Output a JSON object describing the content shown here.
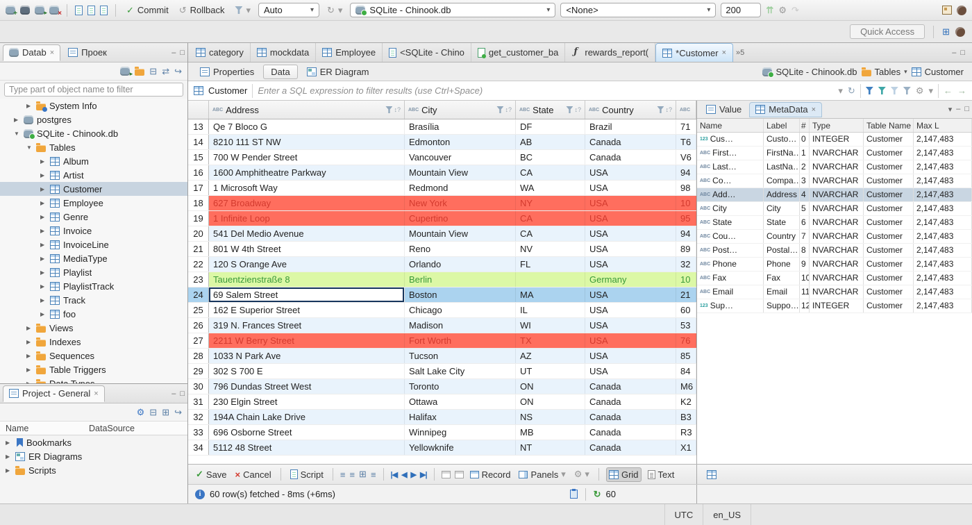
{
  "icons": {
    "caret": "▾",
    "close": "×",
    "check": "✓",
    "cross": "×",
    "gear": "⚙",
    "refresh": "↻",
    "history": "↺",
    "sort_hint": "↕?",
    "lines": "≡",
    "nav_first": "|◀",
    "nav_prev": "◀",
    "nav_next": "▶",
    "nav_last": "▶|",
    "min": "–",
    "max": "□",
    "collapse_all": "⊟",
    "expand_all": "⊞",
    "link_editor": "⇄",
    "jump": "↪",
    "up2": "⇈",
    "redo": "↷",
    "back_arrow": "←",
    "fwd_arrow": "→",
    "overflow": "»"
  },
  "toolbar": {
    "commit_label": "Commit",
    "rollback_label": "Rollback",
    "tx_mode": "Auto",
    "database": "SQLite - Chinook.db",
    "schema": "<None>",
    "fetch_size": "200",
    "quick_access": "Quick Access"
  },
  "navigator": {
    "tab_database": "Datab",
    "tab_project": "Проек",
    "filter_placeholder": "Type part of object name to filter",
    "tree": [
      {
        "arrow": "▶",
        "label": "System Info",
        "row_class": "d2",
        "icon_class": "i-folder i-folder-info"
      },
      {
        "arrow": "▶",
        "label": "postgres",
        "row_class": "d1",
        "icon_class": "i-db"
      },
      {
        "arrow": "▼",
        "label": "SQLite - Chinook.db",
        "row_class": "d1",
        "icon_class": "i-db i-db-on"
      },
      {
        "arrow": "▼",
        "label": "Tables",
        "row_class": "d2",
        "icon_class": "i-folder"
      },
      {
        "arrow": "▶",
        "label": "Album",
        "row_class": "d3",
        "icon_class": "i-table"
      },
      {
        "arrow": "▶",
        "label": "Artist",
        "row_class": "d3",
        "icon_class": "i-table"
      },
      {
        "arrow": "▶",
        "label": "Customer",
        "row_class": "d3 selected",
        "icon_class": "i-table"
      },
      {
        "arrow": "▶",
        "label": "Employee",
        "row_class": "d3",
        "icon_class": "i-table"
      },
      {
        "arrow": "▶",
        "label": "Genre",
        "row_class": "d3",
        "icon_class": "i-table"
      },
      {
        "arrow": "▶",
        "label": "Invoice",
        "row_class": "d3",
        "icon_class": "i-table"
      },
      {
        "arrow": "▶",
        "label": "InvoiceLine",
        "row_class": "d3",
        "icon_class": "i-table"
      },
      {
        "arrow": "▶",
        "label": "MediaType",
        "row_class": "d3",
        "icon_class": "i-table"
      },
      {
        "arrow": "▶",
        "label": "Playlist",
        "row_class": "d3",
        "icon_class": "i-table"
      },
      {
        "arrow": "▶",
        "label": "PlaylistTrack",
        "row_class": "d3",
        "icon_class": "i-table"
      },
      {
        "arrow": "▶",
        "label": "Track",
        "row_class": "d3",
        "icon_class": "i-table"
      },
      {
        "arrow": "▶",
        "label": "foo",
        "row_class": "d3",
        "icon_class": "i-table"
      },
      {
        "arrow": "▶",
        "label": "Views",
        "row_class": "d2",
        "icon_class": "i-folder"
      },
      {
        "arrow": "▶",
        "label": "Indexes",
        "row_class": "d2",
        "icon_class": "i-folder"
      },
      {
        "arrow": "▶",
        "label": "Sequences",
        "row_class": "d2",
        "icon_class": "i-folder"
      },
      {
        "arrow": "▶",
        "label": "Table Triggers",
        "row_class": "d2",
        "icon_class": "i-folder"
      },
      {
        "arrow": "▶",
        "label": "Data Types",
        "row_class": "d2",
        "icon_class": "i-folder"
      }
    ]
  },
  "project_panel": {
    "title": "Project - General",
    "col_name": "Name",
    "col_datasource": "DataSource",
    "items": [
      {
        "arrow": "▶",
        "label": "Bookmarks",
        "icon_class": "i-bookmark"
      },
      {
        "arrow": "▶",
        "label": "ER Diagrams",
        "icon_class": "i-erd"
      },
      {
        "arrow": "▶",
        "label": "Scripts",
        "icon_class": "i-folder"
      }
    ]
  },
  "editor_tabs": {
    "tabs": [
      {
        "label": "category",
        "icon_class": "i-table",
        "tab_class": "",
        "close": ""
      },
      {
        "label": "mockdata",
        "icon_class": "i-table",
        "tab_class": "",
        "close": ""
      },
      {
        "label": "Employee",
        "icon_class": "i-table",
        "tab_class": "",
        "close": ""
      },
      {
        "label": "<SQLite - Chino",
        "icon_class": "i-sqlpage",
        "tab_class": "",
        "close": ""
      },
      {
        "label": "get_customer_ba",
        "icon_class": "i-sqlgreen",
        "tab_class": "",
        "close": ""
      },
      {
        "label": "rewards_report(",
        "icon_class": "i-fn",
        "tab_class": "",
        "close": ""
      },
      {
        "label": "*Customer",
        "icon_class": "i-table",
        "tab_class": "active",
        "close": "×"
      }
    ],
    "overflow_count": "5"
  },
  "result_tabs": {
    "properties": "Properties",
    "data": "Data",
    "er": "ER Diagram"
  },
  "breadcrumb": {
    "db": "SQLite - Chinook.db",
    "tables": "Tables",
    "table": "Customer"
  },
  "filter": {
    "table": "Customer",
    "placeholder": "Enter a SQL expression to filter results (use Ctrl+Space)"
  },
  "grid": {
    "columns": [
      "Address",
      "City",
      "State",
      "Country"
    ],
    "rows": [
      {
        "num": "13",
        "row_class": "",
        "cells": [
          "Qe 7 Bloco G",
          "Brasília",
          "DF",
          "Brazil",
          "71"
        ]
      },
      {
        "num": "14",
        "row_class": "alt",
        "cells": [
          "8210 111 ST NW",
          "Edmonton",
          "AB",
          "Canada",
          "T6"
        ]
      },
      {
        "num": "15",
        "row_class": "",
        "cells": [
          "700 W Pender Street",
          "Vancouver",
          "BC",
          "Canada",
          "V6"
        ]
      },
      {
        "num": "16",
        "row_class": "alt",
        "cells": [
          "1600 Amphitheatre Parkway",
          "Mountain View",
          "CA",
          "USA",
          "94"
        ]
      },
      {
        "num": "17",
        "row_class": "",
        "cells": [
          "1 Microsoft Way",
          "Redmond",
          "WA",
          "USA",
          "98"
        ]
      },
      {
        "num": "18",
        "row_class": "red",
        "cells": [
          "627 Broadway",
          "New York",
          "NY",
          "USA",
          "10"
        ]
      },
      {
        "num": "19",
        "row_class": "red",
        "cells": [
          "1 Infinite Loop",
          "Cupertino",
          "CA",
          "USA",
          "95"
        ]
      },
      {
        "num": "20",
        "row_class": "alt",
        "cells": [
          "541 Del Medio Avenue",
          "Mountain View",
          "CA",
          "USA",
          "94"
        ]
      },
      {
        "num": "21",
        "row_class": "",
        "cells": [
          "801 W 4th Street",
          "Reno",
          "NV",
          "USA",
          "89"
        ]
      },
      {
        "num": "22",
        "row_class": "alt",
        "cells": [
          "120 S Orange Ave",
          "Orlando",
          "FL",
          "USA",
          "32"
        ]
      },
      {
        "num": "23",
        "row_class": "green",
        "cells": [
          "Tauentzienstraße 8",
          "Berlin",
          "",
          "Germany",
          "10"
        ]
      },
      {
        "num": "24",
        "row_class": "sel",
        "cell0_class": "focus",
        "cells": [
          "69 Salem Street",
          "Boston",
          "MA",
          "USA",
          "21"
        ]
      },
      {
        "num": "25",
        "row_class": "",
        "cells": [
          "162 E Superior Street",
          "Chicago",
          "IL",
          "USA",
          "60"
        ]
      },
      {
        "num": "26",
        "row_class": "alt",
        "cells": [
          "319 N. Frances Street",
          "Madison",
          "WI",
          "USA",
          "53"
        ]
      },
      {
        "num": "27",
        "row_class": "red",
        "cells": [
          "2211 W Berry Street",
          "Fort Worth",
          "TX",
          "USA",
          "76"
        ]
      },
      {
        "num": "28",
        "row_class": "alt",
        "cells": [
          "1033 N Park Ave",
          "Tucson",
          "AZ",
          "USA",
          "85"
        ]
      },
      {
        "num": "29",
        "row_class": "",
        "cells": [
          "302 S 700 E",
          "Salt Lake City",
          "UT",
          "USA",
          "84"
        ]
      },
      {
        "num": "30",
        "row_class": "alt",
        "cells": [
          "796 Dundas Street West",
          "Toronto",
          "ON",
          "Canada",
          "M6"
        ]
      },
      {
        "num": "31",
        "row_class": "",
        "cells": [
          "230 Elgin Street",
          "Ottawa",
          "ON",
          "Canada",
          "K2"
        ]
      },
      {
        "num": "32",
        "row_class": "alt",
        "cells": [
          "194A Chain Lake Drive",
          "Halifax",
          "NS",
          "Canada",
          "B3"
        ]
      },
      {
        "num": "33",
        "row_class": "",
        "cells": [
          "696 Osborne Street",
          "Winnipeg",
          "MB",
          "Canada",
          "R3"
        ]
      },
      {
        "num": "34",
        "row_class": "alt",
        "cells": [
          "5112 48 Street",
          "Yellowknife",
          "NT",
          "Canada",
          "X1"
        ]
      }
    ]
  },
  "meta_panel": {
    "tab_value": "Value",
    "tab_meta": "MetaData",
    "columns": {
      "name": "Name",
      "label": "Label",
      "num": "#",
      "type": "Type",
      "table": "Table Name",
      "max": "Max L"
    },
    "rows": [
      {
        "icon": "123",
        "icon_class": "mi-num",
        "name": "Cus…",
        "label": "Custo…",
        "num": "0",
        "type": "INTEGER",
        "table": "Customer",
        "max": "2,147,483",
        "row_class": ""
      },
      {
        "icon": "ABC",
        "icon_class": "mi-abc",
        "name": "First…",
        "label": "FirstNa…",
        "num": "1",
        "type": "NVARCHAR",
        "table": "Customer",
        "max": "2,147,483",
        "row_class": ""
      },
      {
        "icon": "ABC",
        "icon_class": "mi-abc",
        "name": "Last…",
        "label": "LastNa…",
        "num": "2",
        "type": "NVARCHAR",
        "table": "Customer",
        "max": "2,147,483",
        "row_class": ""
      },
      {
        "icon": "ABC",
        "icon_class": "mi-abc",
        "name": "Co…",
        "label": "Compa…",
        "num": "3",
        "type": "NVARCHAR",
        "table": "Customer",
        "max": "2,147,483",
        "row_class": ""
      },
      {
        "icon": "ABC",
        "icon_class": "mi-abc",
        "name": "Add…",
        "label": "Address",
        "num": "4",
        "type": "NVARCHAR",
        "table": "Customer",
        "max": "2,147,483",
        "row_class": "selected"
      },
      {
        "icon": "ABC",
        "icon_class": "mi-abc",
        "name": "City",
        "label": "City",
        "num": "5",
        "type": "NVARCHAR",
        "table": "Customer",
        "max": "2,147,483",
        "row_class": ""
      },
      {
        "icon": "ABC",
        "icon_class": "mi-abc",
        "name": "State",
        "label": "State",
        "num": "6",
        "type": "NVARCHAR",
        "table": "Customer",
        "max": "2,147,483",
        "row_class": ""
      },
      {
        "icon": "ABC",
        "icon_class": "mi-abc",
        "name": "Cou…",
        "label": "Country",
        "num": "7",
        "type": "NVARCHAR",
        "table": "Customer",
        "max": "2,147,483",
        "row_class": ""
      },
      {
        "icon": "ABC",
        "icon_class": "mi-abc",
        "name": "Post…",
        "label": "Postal…",
        "num": "8",
        "type": "NVARCHAR",
        "table": "Customer",
        "max": "2,147,483",
        "row_class": ""
      },
      {
        "icon": "ABC",
        "icon_class": "mi-abc",
        "name": "Phone",
        "label": "Phone",
        "num": "9",
        "type": "NVARCHAR",
        "table": "Customer",
        "max": "2,147,483",
        "row_class": ""
      },
      {
        "icon": "ABC",
        "icon_class": "mi-abc",
        "name": "Fax",
        "label": "Fax",
        "num": "10",
        "type": "NVARCHAR",
        "table": "Customer",
        "max": "2,147,483",
        "row_class": ""
      },
      {
        "icon": "ABC",
        "icon_class": "mi-abc",
        "name": "Email",
        "label": "Email",
        "num": "11",
        "type": "NVARCHAR",
        "table": "Customer",
        "max": "2,147,483",
        "row_class": ""
      },
      {
        "icon": "123",
        "icon_class": "mi-num",
        "name": "Sup…",
        "label": "Suppo…",
        "num": "12",
        "type": "INTEGER",
        "table": "Customer",
        "max": "2,147,483",
        "row_class": ""
      }
    ]
  },
  "bottom_toolbar": {
    "save": "Save",
    "cancel": "Cancel",
    "script": "Script",
    "record": "Record",
    "panels": "Panels",
    "grid": "Grid",
    "text": "Text"
  },
  "status": {
    "fetch_info": "60 row(s) fetched - 8ms (+6ms)",
    "refresh_count": "60"
  },
  "statusbar": {
    "tz": "UTC",
    "locale": "en_US"
  }
}
